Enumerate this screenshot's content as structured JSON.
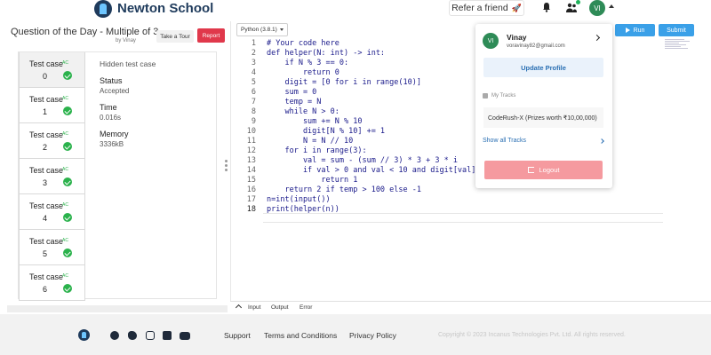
{
  "nav": {
    "brand": "Newton School",
    "refer_label": "Refer a friend",
    "refer_emoji": "🚀",
    "avatar_initials": "VI"
  },
  "question": {
    "title": "Question of the Day - Multiple of 3",
    "by": "by Vinay",
    "tour_label": "Take a Tour",
    "report_label": "Report"
  },
  "test_cases": [
    {
      "label": "Test case",
      "num": "0",
      "status": "AC"
    },
    {
      "label": "Test case",
      "num": "1",
      "status": "AC"
    },
    {
      "label": "Test case",
      "num": "2",
      "status": "AC"
    },
    {
      "label": "Test case",
      "num": "3",
      "status": "AC"
    },
    {
      "label": "Test case",
      "num": "4",
      "status": "AC"
    },
    {
      "label": "Test case",
      "num": "5",
      "status": "AC"
    },
    {
      "label": "Test case",
      "num": "6",
      "status": "AC"
    }
  ],
  "details": {
    "hidden": "Hidden test case",
    "status_label": "Status",
    "status_value": "Accepted",
    "time_label": "Time",
    "time_value": "0.016s",
    "memory_label": "Memory",
    "memory_value": "3336kB"
  },
  "editor": {
    "language": "Python (3.8.1)",
    "run_label": "Run",
    "submit_label": "Submit",
    "lines": [
      "# Your code here",
      "def helper(N: int) -> int:",
      "    if N % 3 == 0:",
      "        return 0",
      "    digit = [0 for i in range(10)]",
      "    sum = 0",
      "    temp = N",
      "    while N > 0:",
      "        sum += N % 10",
      "        digit[N % 10] += 1",
      "        N = N // 10",
      "    for i in range(3):",
      "        val = sum - (sum // 3) * 3 + 3 * i",
      "        if val > 0 and val < 10 and digit[val] > 0:",
      "            return 1",
      "    return 2 if temp > 100 else -1",
      "n=int(input())",
      "print(helper(n))"
    ],
    "line_numbers": [
      "1",
      "2",
      "3",
      "4",
      "5",
      "6",
      "7",
      "8",
      "9",
      "10",
      "11",
      "12",
      "13",
      "14",
      "15",
      "16",
      "17",
      "18"
    ],
    "io_tabs": [
      "Input",
      "Output",
      "Error"
    ]
  },
  "dropdown": {
    "initials": "VI",
    "name": "Vinay",
    "email": "voravinay82@gmail.com",
    "update_label": "Update Profile",
    "tracks_label": "My Tracks",
    "track_name": "CodeRush-X (Prizes worth ₹10,00,000)",
    "show_all_label": "Show all Tracks",
    "logout_label": "Logout"
  },
  "footer": {
    "links": [
      "Support",
      "Terms and Conditions",
      "Privacy Policy"
    ],
    "copyright": "Copyright © 2023 Incanus Technologies Pvt. Ltd. All rights reserved."
  },
  "colors": {
    "accent_blue": "#3aa0e8",
    "report_red": "#e0384b",
    "ac_green": "#2bb24c",
    "logout_pink": "#f59a9f"
  },
  "icons": [
    "bell-icon",
    "people-icon",
    "check-icon",
    "logout-icon",
    "facebook-icon",
    "twitter-icon",
    "instagram-icon",
    "linkedin-icon",
    "youtube-icon"
  ]
}
